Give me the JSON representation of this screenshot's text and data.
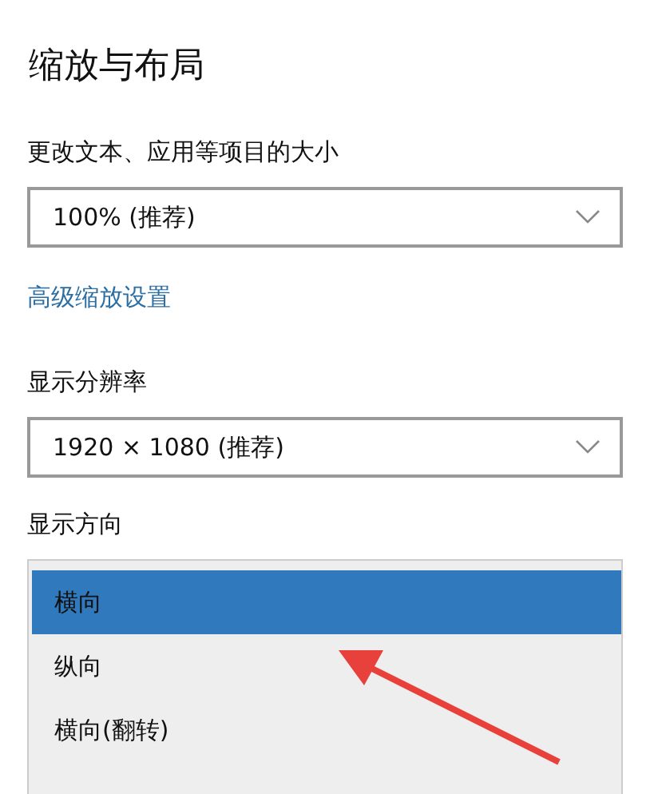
{
  "title": "缩放与布局",
  "scale": {
    "label": "更改文本、应用等项目的大小",
    "value": "100% (推荐)"
  },
  "advanced_link": "高级缩放设置",
  "resolution": {
    "label": "显示分辨率",
    "value": "1920 × 1080 (推荐)"
  },
  "orientation": {
    "label": "显示方向",
    "options": [
      {
        "label": "横向",
        "selected": true
      },
      {
        "label": "纵向",
        "selected": false
      },
      {
        "label": "横向(翻转)",
        "selected": false
      }
    ]
  }
}
